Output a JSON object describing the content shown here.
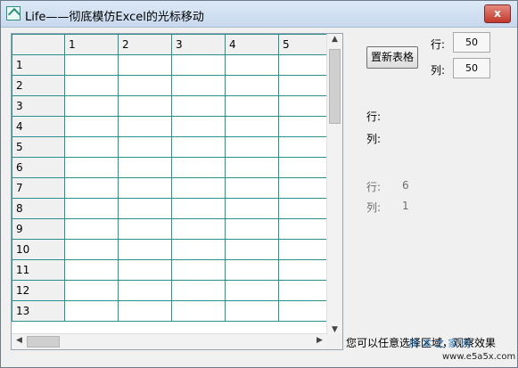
{
  "window": {
    "title": "Life——彻底模仿Excel的光标移动",
    "close_label": "x"
  },
  "grid": {
    "columns": [
      "1",
      "2",
      "3",
      "4",
      "5"
    ],
    "rows": [
      "1",
      "2",
      "3",
      "4",
      "5",
      "6",
      "7",
      "8",
      "9",
      "10",
      "11",
      "12",
      "13"
    ]
  },
  "panel": {
    "reset_label": "置新表格",
    "row_label": "行:",
    "row_value": "50",
    "col_label": "列:",
    "col_value": "50",
    "sel_row_label": "行:",
    "sel_col_label": "列:",
    "cur_row_label": "行:",
    "cur_row_value": "6",
    "cur_col_label": "列:",
    "cur_col_value": "1",
    "hint": "您可以任意选择区域，观察效果"
  },
  "watermark": {
    "text": "脚 本 之 家 网",
    "url": "www.e5a5x.com"
  }
}
